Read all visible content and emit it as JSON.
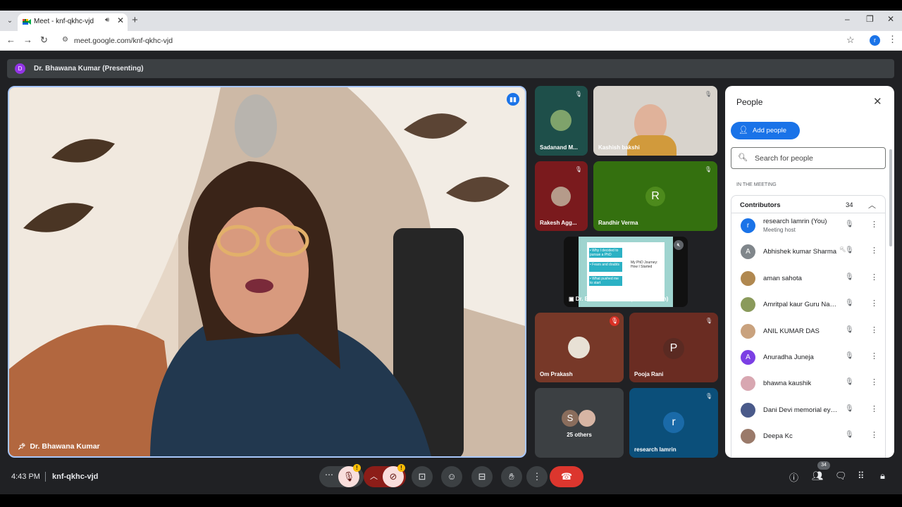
{
  "browser": {
    "tab_title": "Meet - knf-qkhc-vjd",
    "url": "meet.google.com/knf-qkhc-vjd",
    "profile_initial": "r"
  },
  "banner": {
    "avatar_initial": "D",
    "text": "Dr. Bhawana Kumar (Presenting)"
  },
  "main_speaker": {
    "name": "Dr. Bhawana Kumar"
  },
  "tiles": [
    {
      "name": "Sadanand M..."
    },
    {
      "name": "Kashish bakshi"
    },
    {
      "name": "Rakesh Agg..."
    },
    {
      "name": "Randhir Verma",
      "initial": "R"
    },
    {
      "name": "Dr. Bhawana Kumar (Presentation)"
    },
    {
      "name": "Om Prakash"
    },
    {
      "name": "Pooja Rani",
      "initial": "P"
    },
    {
      "name": "25 others",
      "initial": "S"
    },
    {
      "name": "research lamrin",
      "initial": "r"
    }
  ],
  "slide": {
    "bullets": [
      "• Why I decided to pursue a PhD",
      "• Fears and doubts",
      "• What pushed me to start"
    ],
    "heading": "My PhD Journey: How I Started"
  },
  "people_panel": {
    "title": "People",
    "add_people": "Add people",
    "search_placeholder": "Search for people",
    "section_label": "IN THE MEETING",
    "group_label": "Contributors",
    "group_count": "34",
    "people": [
      {
        "name": "research lamrin (You)",
        "sub": "Meeting host",
        "initial": "r",
        "color": "#1a73e8"
      },
      {
        "name": "Abhishek kumar Sharma",
        "initial": "A",
        "color": "#80868b"
      },
      {
        "name": "aman sahota",
        "initial": "",
        "color": "#b08850"
      },
      {
        "name": "Amritpal kaur Guru Nanak",
        "initial": "",
        "color": "#8a9a5b"
      },
      {
        "name": "ANIL KUMAR DAS",
        "initial": "",
        "color": "#c9a27e"
      },
      {
        "name": "Anuradha Juneja",
        "initial": "A",
        "color": "#7b3fe4"
      },
      {
        "name": "bhawna kaushik",
        "initial": "",
        "color": "#d8a7b1"
      },
      {
        "name": "Dani Devi memorial eye hospital",
        "initial": "",
        "color": "#4a5a8a"
      },
      {
        "name": "Deepa Kc",
        "initial": "",
        "color": "#9a7a6a"
      }
    ]
  },
  "footer": {
    "time": "4:43 PM",
    "meeting_code": "knf-qkhc-vjd",
    "participant_count": "34"
  },
  "colors": {
    "meet_bg": "#202124",
    "accent_blue": "#1a73e8",
    "end_call_red": "#dc362e"
  }
}
